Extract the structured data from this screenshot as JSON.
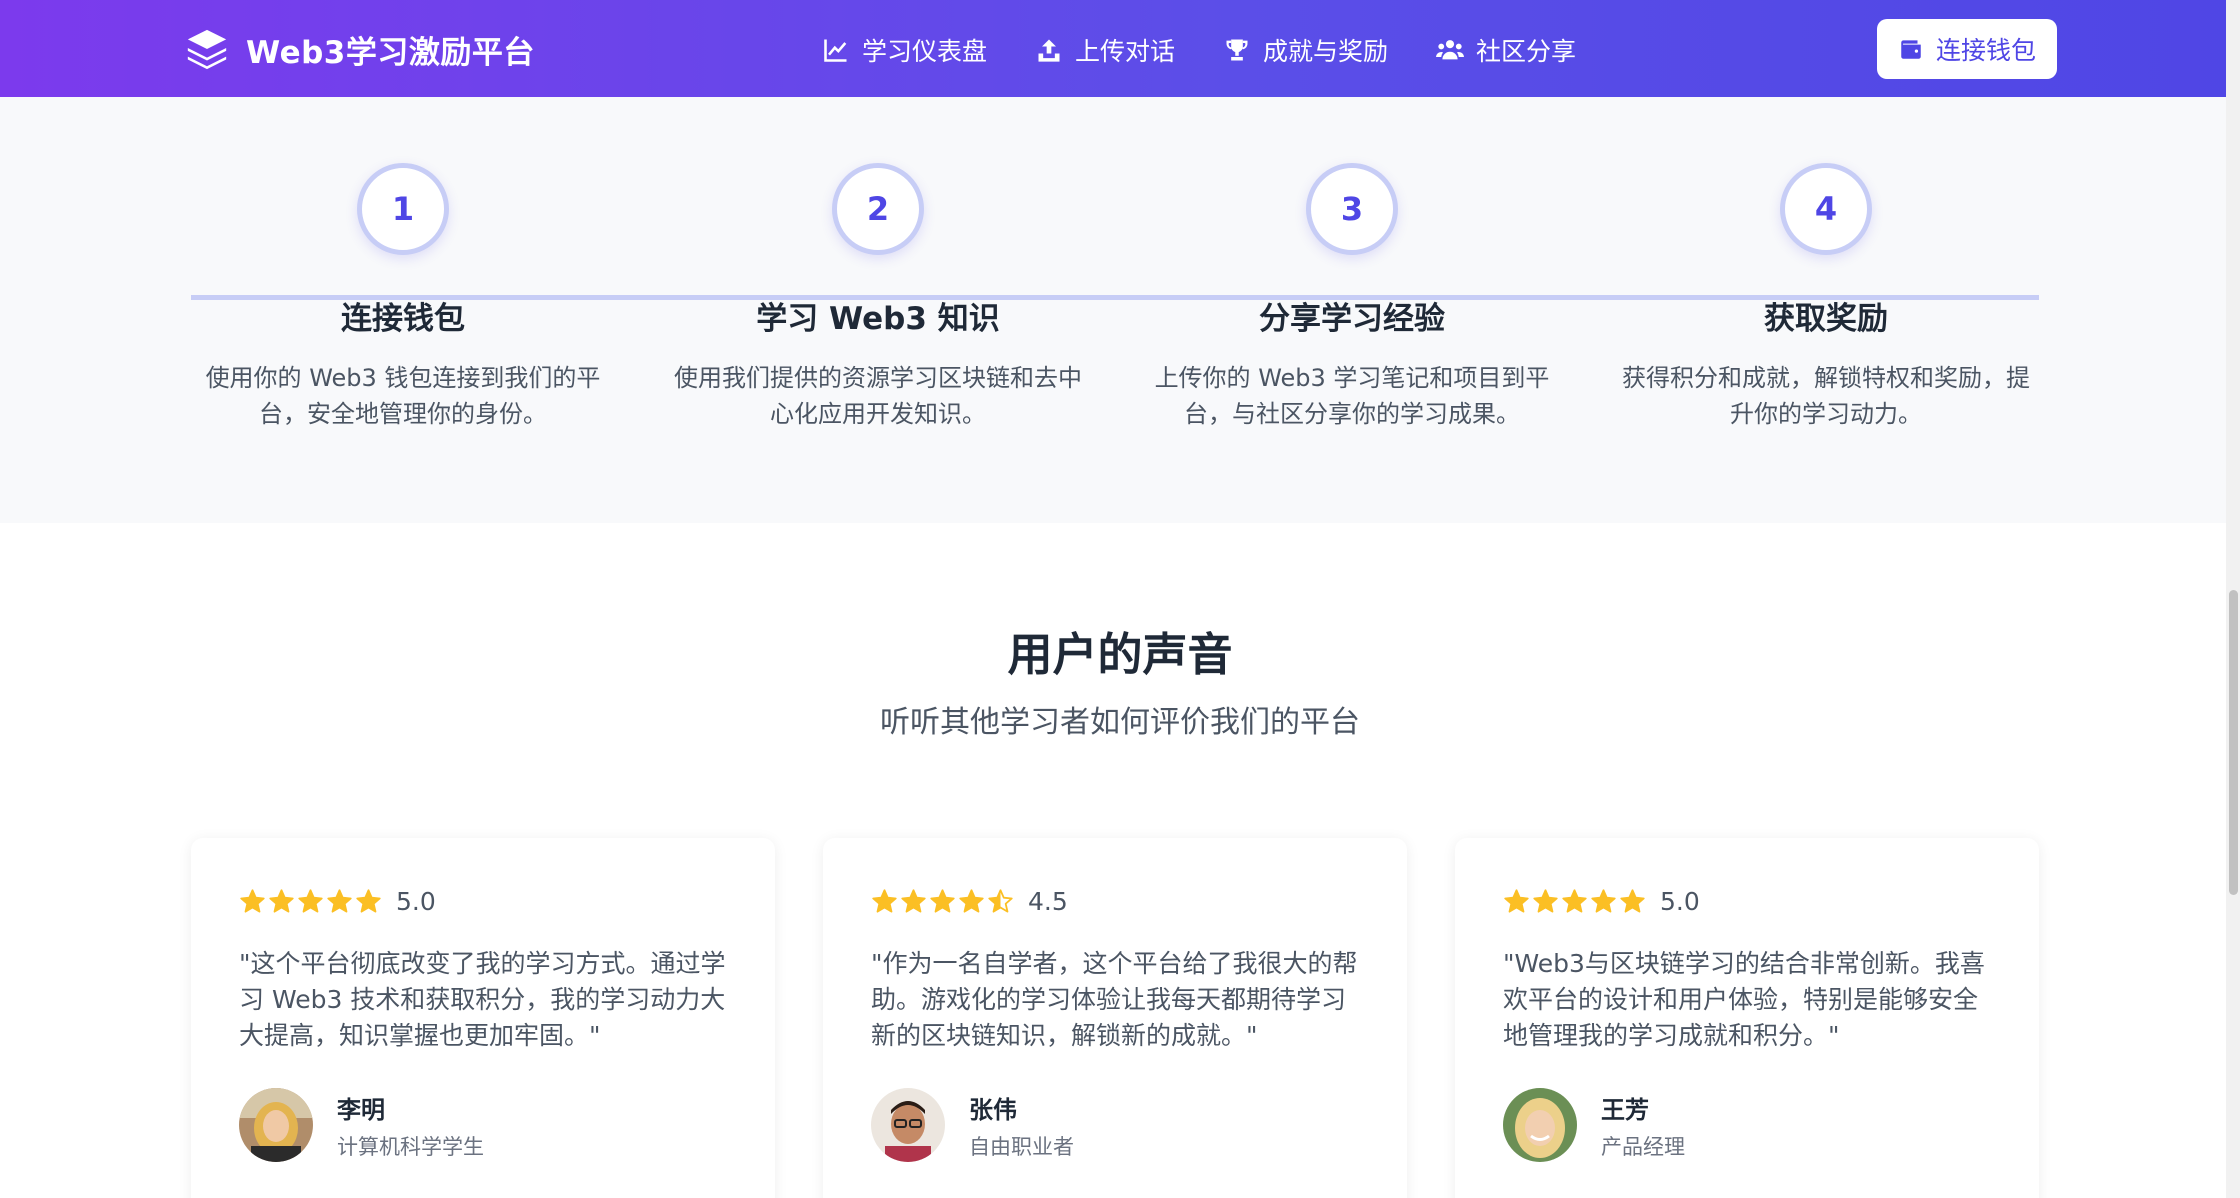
{
  "nav": {
    "brand": "Web3学习激励平台",
    "links": [
      {
        "label": "学习仪表盘",
        "icon": "chart-line-icon"
      },
      {
        "label": "上传对话",
        "icon": "upload-icon"
      },
      {
        "label": "成就与奖励",
        "icon": "trophy-icon"
      },
      {
        "label": "社区分享",
        "icon": "users-icon"
      }
    ],
    "wallet_button": "连接钱包"
  },
  "steps": [
    {
      "number": "1",
      "title": "连接钱包",
      "desc": "使用你的 Web3 钱包连接到我们的平台，安全地管理你的身份。"
    },
    {
      "number": "2",
      "title": "学习 Web3 知识",
      "desc": "使用我们提供的资源学习区块链和去中心化应用开发知识。"
    },
    {
      "number": "3",
      "title": "分享学习经验",
      "desc": "上传你的 Web3 学习笔记和项目到平台，与社区分享你的学习成果。"
    },
    {
      "number": "4",
      "title": "获取奖励",
      "desc": "获得积分和成就，解锁特权和奖励，提升你的学习动力。"
    }
  ],
  "testimonials": {
    "title": "用户的声音",
    "subtitle": "听听其他学习者如何评价我们的平台",
    "items": [
      {
        "rating": "5.0",
        "stars": 5,
        "quote": "\"这个平台彻底改变了我的学习方式。通过学习 Web3 技术和获取积分，我的学习动力大大提高，知识掌握也更加牢固。\"",
        "name": "李明",
        "role": "计算机科学学生"
      },
      {
        "rating": "4.5",
        "stars": 4.5,
        "quote": "\"作为一名自学者，这个平台给了我很大的帮助。游戏化的学习体验让我每天都期待学习新的区块链知识，解锁新的成就。\"",
        "name": "张伟",
        "role": "自由职业者"
      },
      {
        "rating": "5.0",
        "stars": 5,
        "quote": "\"Web3与区块链学习的结合非常创新。我喜欢平台的设计和用户体验，特别是能够安全地管理我的学习成就和积分。\"",
        "name": "王芳",
        "role": "产品经理"
      }
    ]
  },
  "colors": {
    "primary": "#4f46e5",
    "gradient_start": "#7c3aed",
    "star": "#fbbf24"
  }
}
